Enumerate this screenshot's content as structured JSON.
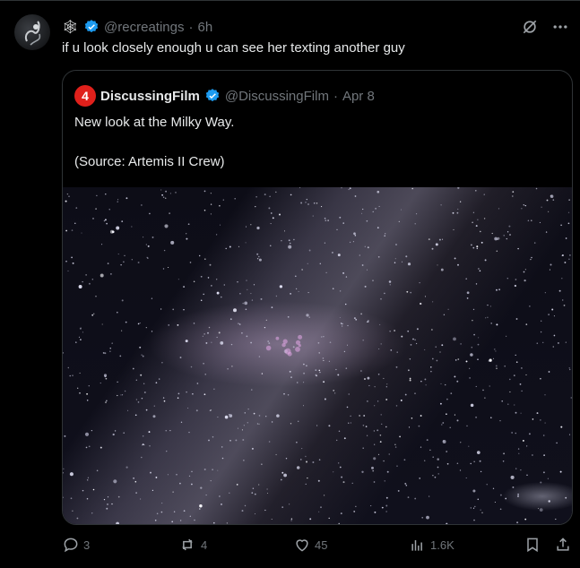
{
  "tweet": {
    "emoji": "🕸",
    "handle": "@recreatings",
    "separator": "·",
    "time": "6h",
    "text": "if u look closely enough u can see her texting another guy"
  },
  "quoted": {
    "logo_text": "4",
    "name": "DiscussingFilm",
    "handle": "@DiscussingFilm",
    "separator": "·",
    "time": "Apr 8",
    "line1": "New look at the Milky Way.",
    "line2": "(Source: Artemis II Crew)"
  },
  "actions": {
    "replies": "3",
    "reposts": "4",
    "likes": "45",
    "views": "1.6K"
  },
  "colors": {
    "background": "#000000",
    "text": "#e7e9ea",
    "muted": "#71767b",
    "border": "#2f3336",
    "verified": "#1d9bf0",
    "logo": "#e0201b"
  }
}
